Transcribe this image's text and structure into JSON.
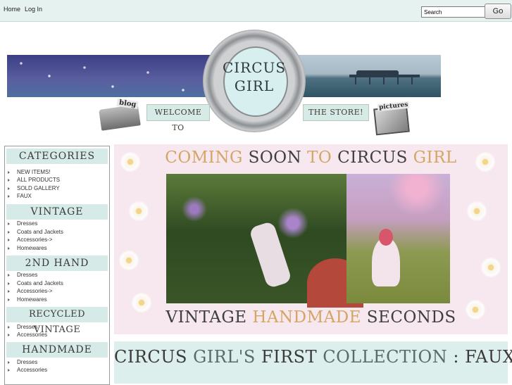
{
  "topnav": {
    "home": "Home",
    "login": "Log In"
  },
  "search": {
    "value": "Search",
    "button": "Go"
  },
  "header": {
    "logo_line1": "CIRCUS",
    "logo_line2": "GIRL",
    "welcome_left": "WELCOME TO",
    "welcome_right": "THE STORE!",
    "blog_label": "blog",
    "pictures_label": "pictures"
  },
  "sidebar": {
    "categories": {
      "title": "CATEGORIES",
      "items": [
        "NEW ITEMS!",
        "ALL PRODUCTS",
        "SOLD GALLERY",
        "FAUX"
      ]
    },
    "vintage": {
      "title": "VINTAGE",
      "items": [
        "Dresses",
        "Coats and Jackets",
        "Accessories->",
        "Homewares"
      ]
    },
    "second_hand": {
      "title": "2ND HAND",
      "items": [
        "Dresses",
        "Coats and Jackets",
        "Accessories->",
        "Homewares"
      ]
    },
    "recycled_vintage": {
      "title": "RECYCLED VINTAGE",
      "items": [
        "Dresses",
        "Accessories"
      ]
    },
    "handmade": {
      "title": "HANDMADE",
      "items": [
        "Dresses",
        "Accessories"
      ]
    }
  },
  "promo": {
    "title_w1": "COMING",
    "title_w2": "SOON",
    "title_w3": "TO",
    "title_w4": "CIRCUS",
    "title_w5": "GIRL",
    "sub_w1": "VINTAGE",
    "sub_w2": "HANDMADE",
    "sub_w3": "SECONDS"
  },
  "collection": {
    "w1": "CIRCUS",
    "w2": "GIRL'S",
    "w3": "FIRST",
    "w4": "COLLECTION",
    "w5": ":",
    "w6": "FAUX"
  },
  "colors": {
    "accent_mint": "#d6ebe8",
    "accent_gold": "#d4a565",
    "promo_bg": "#f6e8ee"
  }
}
